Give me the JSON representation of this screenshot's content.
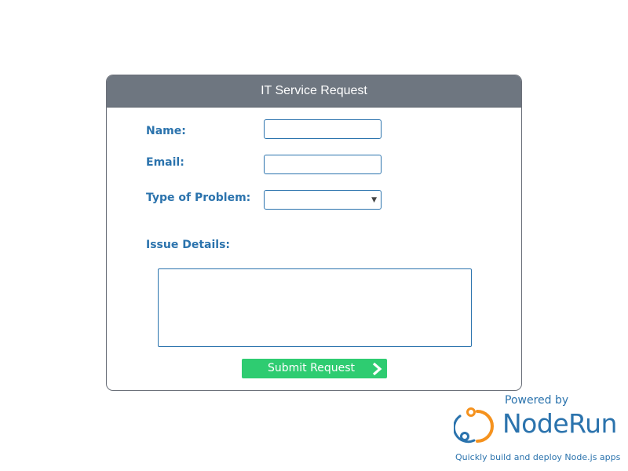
{
  "form": {
    "title": "IT Service Request",
    "fields": {
      "name_label": "Name:",
      "name_value": "",
      "email_label": "Email:",
      "email_value": "",
      "problem_type_label": "Type of Problem:",
      "problem_type_value": "",
      "details_label": "Issue Details:",
      "details_value": ""
    },
    "submit_label": "Submit Request"
  },
  "branding": {
    "powered_by": "Powered by",
    "product_name": "NodeRun",
    "tagline": "Quickly build and deploy Node.js apps",
    "logo_icon": "noderun-logo-icon",
    "colors": {
      "accent_blue": "#2b73ad",
      "logo_orange": "#f5921e",
      "submit_green": "#2ecc71",
      "header_gray": "#6e7680"
    }
  }
}
